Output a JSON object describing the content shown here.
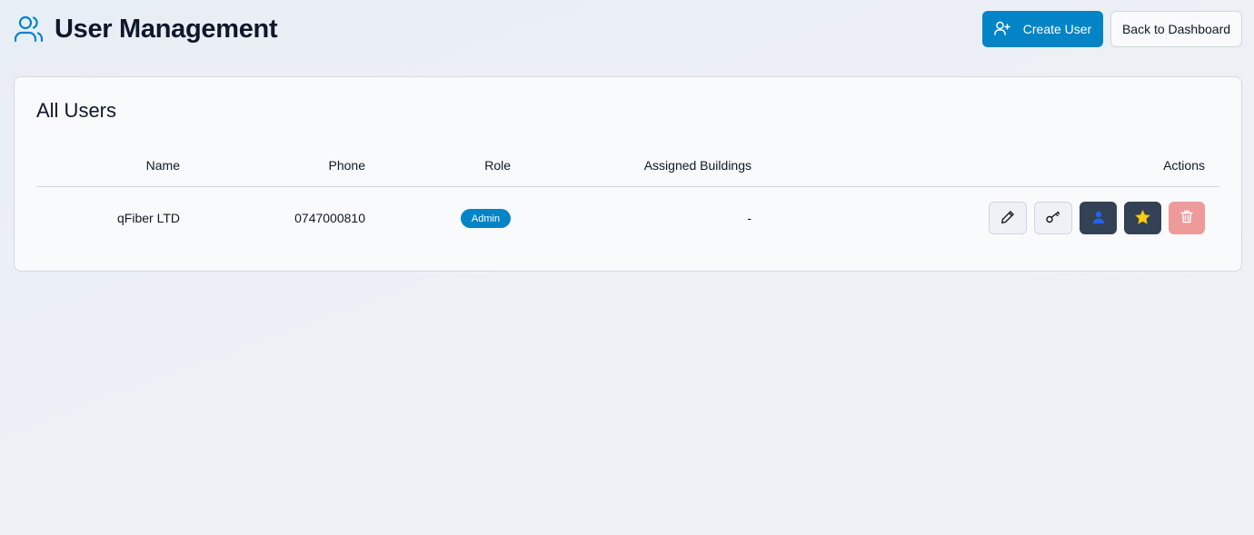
{
  "header": {
    "title": "User Management",
    "title_icon": "users-icon",
    "create_user_label": "Create User",
    "back_label": "Back to Dashboard"
  },
  "card": {
    "title": "All Users",
    "columns": [
      "Name",
      "Phone",
      "Role",
      "Assigned Buildings",
      "Actions"
    ],
    "rows": [
      {
        "name": "qFiber LTD",
        "phone": "0747000810",
        "role": "Admin",
        "assigned_buildings": "-",
        "actions": [
          "edit-icon",
          "key-icon",
          "user-icon",
          "star-icon",
          "trash-icon"
        ]
      }
    ]
  },
  "colors": {
    "accent": "#0284c7",
    "dark_button": "#334155",
    "danger_button": "#ef9a9a",
    "star": "#facc15"
  }
}
